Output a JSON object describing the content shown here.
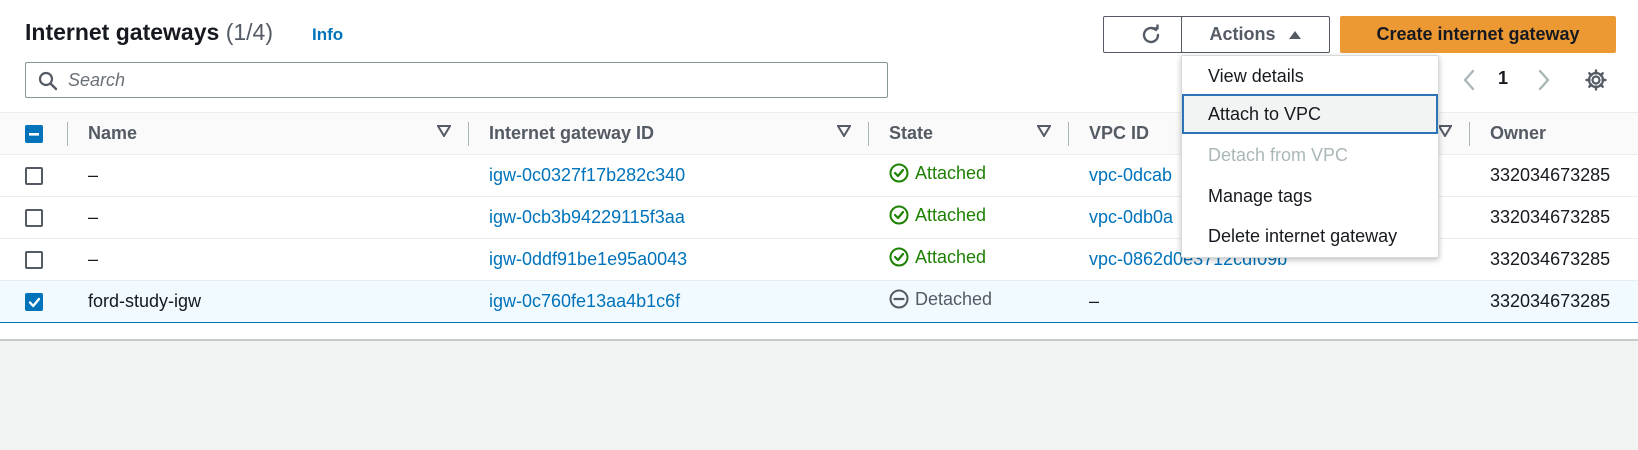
{
  "header": {
    "title": "Internet gateways",
    "count": "(1/4)",
    "info_label": "Info"
  },
  "toolbar": {
    "refresh_icon": "refresh-icon",
    "actions_label": "Actions",
    "create_label": "Create internet gateway"
  },
  "search": {
    "placeholder": "Search",
    "value": ""
  },
  "pagination": {
    "current_page": "1"
  },
  "actions_menu": {
    "items": [
      {
        "label": "View details",
        "state": "normal"
      },
      {
        "label": "Attach to VPC",
        "state": "focused"
      },
      {
        "label": "Detach from VPC",
        "state": "disabled"
      },
      {
        "label": "Manage tags",
        "state": "normal"
      },
      {
        "label": "Delete internet gateway",
        "state": "normal"
      }
    ]
  },
  "table": {
    "columns": [
      "Name",
      "Internet gateway ID",
      "State",
      "VPC ID",
      "Owner"
    ],
    "rows": [
      {
        "name": "–",
        "igw_id": "igw-0c0327f17b282c340",
        "state": "Attached",
        "vpc_id": "vpc-0dcab",
        "owner": "332034673285",
        "selected": false
      },
      {
        "name": "–",
        "igw_id": "igw-0cb3b94229115f3aa",
        "state": "Attached",
        "vpc_id": "vpc-0db0a",
        "owner": "332034673285",
        "selected": false
      },
      {
        "name": "–",
        "igw_id": "igw-0ddf91be1e95a0043",
        "state": "Attached",
        "vpc_id": "vpc-0862d0e3712cdf09b",
        "owner": "332034673285",
        "selected": false
      },
      {
        "name": "ford-study-igw",
        "igw_id": "igw-0c760fe13aa4b1c6f",
        "state": "Detached",
        "vpc_id": "–",
        "owner": "332034673285",
        "selected": true
      }
    ]
  },
  "colors": {
    "link": "#0073bb",
    "attached": "#1d8102",
    "primary_button": "#ec9934"
  }
}
